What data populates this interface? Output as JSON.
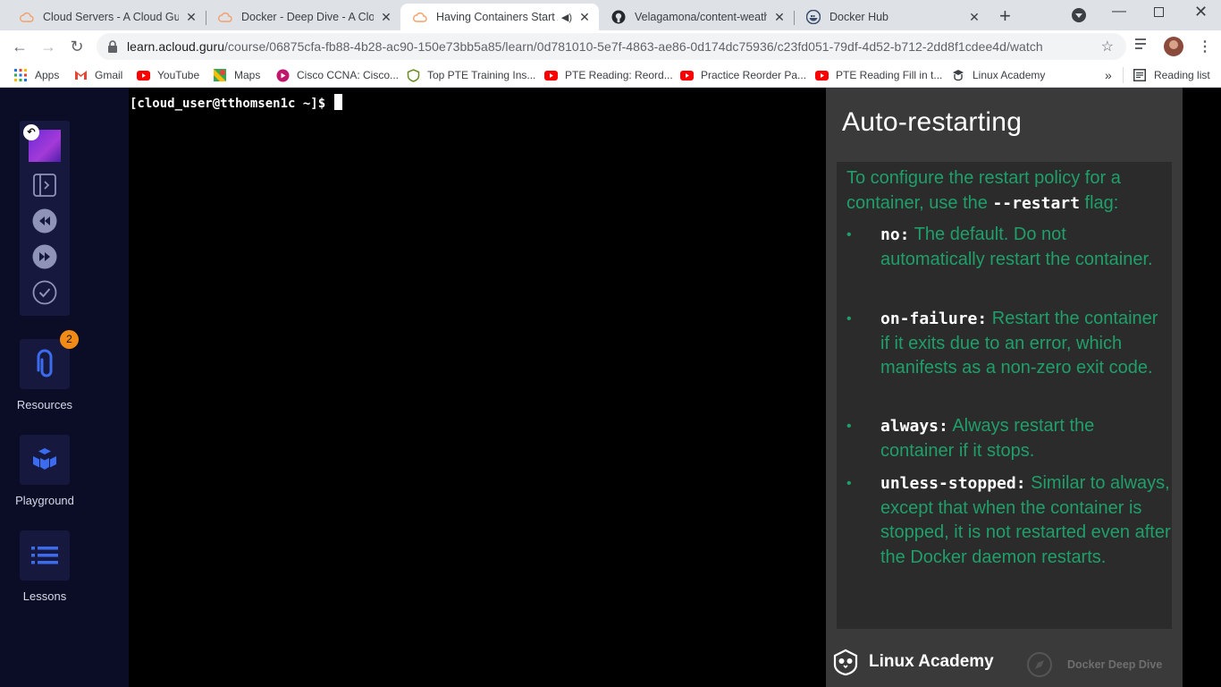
{
  "tabs": [
    {
      "title": "Cloud Servers - A Cloud Guru",
      "icon": "acg-cloud-icon",
      "active": false
    },
    {
      "title": "Docker - Deep Dive - A Cloud",
      "icon": "acg-cloud-icon",
      "active": false
    },
    {
      "title": "Having Containers Start A",
      "icon": "acg-cloud-icon",
      "active": true
    },
    {
      "title": "Velagamona/content-weathe",
      "icon": "github-icon",
      "active": false
    },
    {
      "title": "Docker Hub",
      "icon": "docker-icon",
      "active": false
    }
  ],
  "address": {
    "host": "learn.acloud.guru",
    "path": "/course/06875cfa-fb88-4b28-ac90-150e73bb5a85/learn/0d781010-5e7f-4863-ae86-0d174dc75936/c23fd051-79df-4d52-b712-2dd8f1cdee4d/watch"
  },
  "bookmarks": [
    {
      "label": "Apps",
      "icon": "apps-grid-icon"
    },
    {
      "label": "Gmail",
      "icon": "gmail-icon"
    },
    {
      "label": "YouTube",
      "icon": "youtube-icon"
    },
    {
      "label": "Maps",
      "icon": "maps-icon"
    },
    {
      "label": "Cisco CCNA: Cisco...",
      "icon": "cisco-icon"
    },
    {
      "label": "Top PTE Training Ins...",
      "icon": "pte-icon"
    },
    {
      "label": "PTE Reading: Reord...",
      "icon": "youtube-icon"
    },
    {
      "label": "Practice Reorder Pa...",
      "icon": "youtube-icon"
    },
    {
      "label": "PTE Reading Fill in t...",
      "icon": "youtube-icon"
    },
    {
      "label": "Linux Academy",
      "icon": "linux-academy-icon"
    }
  ],
  "bookmarks_more": "»",
  "reading_list": "Reading list",
  "sidebar": {
    "resources": {
      "label": "Resources",
      "badge": "2"
    },
    "playground": {
      "label": "Playground"
    },
    "lessons": {
      "label": "Lessons"
    }
  },
  "terminal": {
    "prompt": "[cloud_user@tthomsen1c ~]$"
  },
  "slide": {
    "title": "Auto-restarting",
    "intro_before": "To configure the restart policy for a container, use the ",
    "intro_code": "--restart",
    "intro_after": " flag:",
    "bullets": [
      {
        "code": "no:",
        "text": " The default. Do not automatically restart the container."
      },
      {
        "code": "on-failure:",
        "text": " Restart the container if it exits due to an error, which manifests as a non-zero exit code."
      },
      {
        "code": "always:",
        "text": " Always restart the container if it stops."
      },
      {
        "code": "unless-stopped:",
        "text": " Similar to always, except that when the container is stopped, it is not restarted even after the Docker daemon restarts."
      }
    ],
    "footer_brand": "Linux Academy",
    "footer_course": "Docker Deep Dive"
  },
  "colors": {
    "accent_green": "#1f9f6a",
    "sidebar_bg": "#0b0d27",
    "badge": "#f28b16"
  }
}
